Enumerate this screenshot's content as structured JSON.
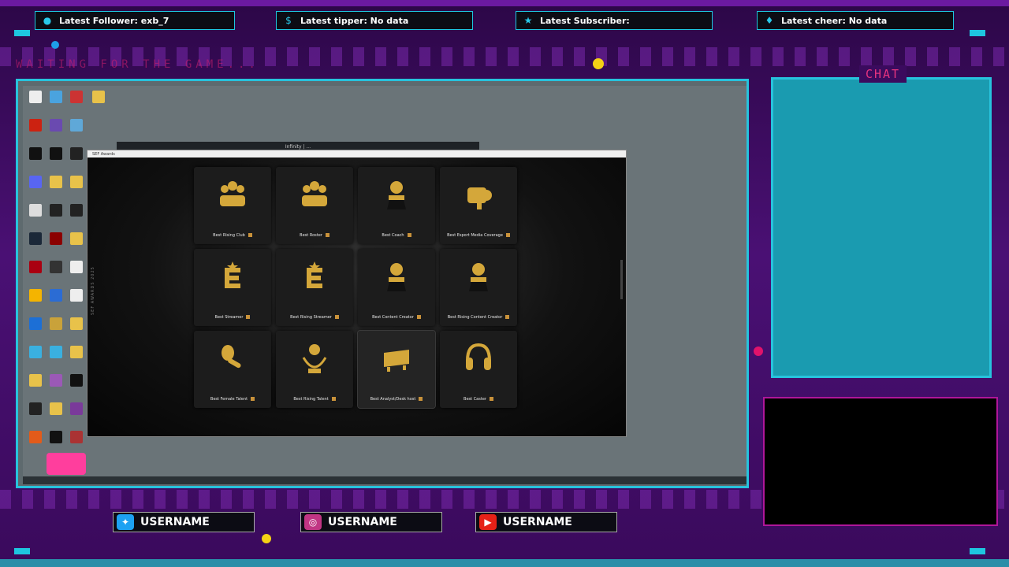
{
  "alerts": {
    "follower": {
      "label": "Latest Follower: exb_7",
      "icon": "user-icon"
    },
    "tipper": {
      "label": "Latest tipper: No data",
      "icon": "dollar-icon"
    },
    "subscriber": {
      "label": "Latest Subscriber:",
      "icon": "star-icon"
    },
    "cheer": {
      "label": "Latest cheer: No data",
      "icon": "diamond-icon"
    }
  },
  "waiting_text": "WAITING FOR THE GAME...",
  "chat": {
    "title": "CHAT"
  },
  "background_window": {
    "title": "Infinity | ..."
  },
  "app": {
    "title": "SEF Awards",
    "side_label": "SEF AWARDS 2025",
    "awards": [
      {
        "label": "Best Rising Club",
        "trophy": "group-trophy"
      },
      {
        "label": "Best Roster",
        "trophy": "group-trophy"
      },
      {
        "label": "Best Coach",
        "trophy": "person-trophy"
      },
      {
        "label": "Best Esport Media Coverage",
        "trophy": "camera-trophy"
      },
      {
        "label": "Best Streamer",
        "trophy": "e-trophy"
      },
      {
        "label": "Best Rising Streamer",
        "trophy": "e-trophy"
      },
      {
        "label": "Best Content Creator",
        "trophy": "person-trophy"
      },
      {
        "label": "Best Rising Content Creator",
        "trophy": "person-trophy"
      },
      {
        "label": "Best Female Talent",
        "trophy": "mic-trophy"
      },
      {
        "label": "Best Rising Talent",
        "trophy": "laurel-trophy"
      },
      {
        "label": "Best Analyst/Desk host",
        "trophy": "desk-trophy"
      },
      {
        "label": "Best Caster",
        "trophy": "headset-trophy"
      }
    ]
  },
  "social": {
    "twitter": {
      "label": "USERNAME",
      "icon": "twitter-icon",
      "color": "#1da1f2"
    },
    "instagram": {
      "label": "USERNAME",
      "icon": "instagram-icon",
      "color": "#c13584"
    },
    "youtube": {
      "label": "USERNAME",
      "icon": "youtube-icon",
      "color": "#e62117"
    }
  },
  "colors": {
    "accent": "#27c3dd",
    "chat_title": "#e5337f",
    "background": "#3b0b5e",
    "trophy_gold": "#d4a73a"
  }
}
